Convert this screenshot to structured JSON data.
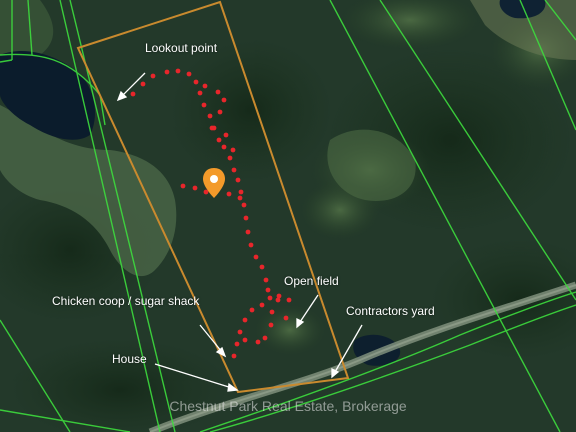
{
  "map": {
    "labels": {
      "lookout": "Lookout point",
      "open_field": "Open field",
      "chicken_coop": "Chicken coop / sugar shack",
      "contractors_yard": "Contractors yard",
      "house": "House"
    },
    "watermark": "Chestnut Park Real Estate, Brokerage",
    "colors": {
      "property_boundary": "#c98a2e",
      "parcel_lines": "#3ddc3d",
      "trail_dots": "#e8262b",
      "marker": "#f39a2a",
      "road": "#7a8a78"
    },
    "icons": {
      "location": "map-pin-icon"
    }
  }
}
